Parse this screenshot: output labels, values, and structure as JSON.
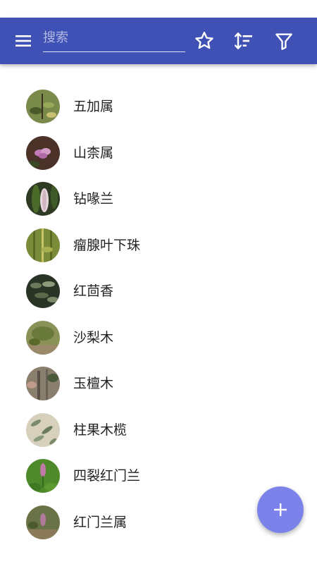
{
  "app_bar": {
    "menu_icon": "menu-icon",
    "search": {
      "placeholder": "搜索",
      "value": ""
    },
    "actions": [
      {
        "icon": "star-outline-icon"
      },
      {
        "icon": "sort-icon"
      },
      {
        "icon": "filter-icon"
      }
    ],
    "color": "#3f51b5"
  },
  "plants": [
    {
      "name": "五加属",
      "thumb_color": "#6b7a3a"
    },
    {
      "name": "山柰属",
      "thumb_color": "#5a3a2e"
    },
    {
      "name": "钻喙兰",
      "thumb_color": "#3d4f2a"
    },
    {
      "name": "瘤腺叶下珠",
      "thumb_color": "#7a8c3a"
    },
    {
      "name": "红茴香",
      "thumb_color": "#2f3a2a"
    },
    {
      "name": "沙梨木",
      "thumb_color": "#7c8a4a"
    },
    {
      "name": "玉檀木",
      "thumb_color": "#6a6052"
    },
    {
      "name": "柱果木榄",
      "thumb_color": "#c9c4b0"
    },
    {
      "name": "四裂红门兰",
      "thumb_color": "#4f8a2a"
    },
    {
      "name": "红门兰属",
      "thumb_color": "#5e6a3a"
    }
  ],
  "fab": {
    "icon": "plus-icon",
    "color": "#7b83eb"
  }
}
